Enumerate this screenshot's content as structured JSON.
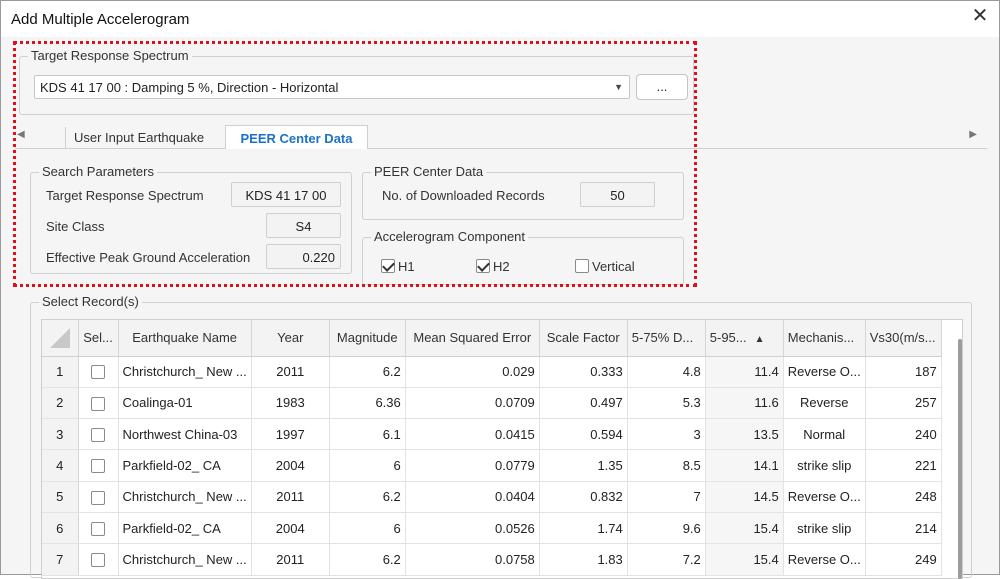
{
  "window": {
    "title": "Add Multiple Accelerogram",
    "close_icon": "✕"
  },
  "target_spectrum": {
    "legend": "Target Response Spectrum",
    "selected": "KDS 41 17 00 : Damping 5 %, Direction - Horizontal",
    "ellipsis_label": "..."
  },
  "tabs": [
    {
      "label": "User Input Earthquake",
      "active": false
    },
    {
      "label": "PEER Center Data",
      "active": true
    }
  ],
  "search": {
    "legend": "Search Parameters",
    "target_label": "Target Response Spectrum",
    "target_value": "KDS 41 17 00",
    "site_label": "Site Class",
    "site_value": "S4",
    "epga_label": "Effective Peak Ground Acceleration",
    "epga_value": "0.220"
  },
  "peer": {
    "legend": "PEER Center Data",
    "records_label": "No. of Downloaded Records",
    "records_value": "50"
  },
  "component": {
    "legend": "Accelerogram Component",
    "h1": {
      "label": "H1",
      "checked": true
    },
    "h2": {
      "label": "H2",
      "checked": true
    },
    "vertical": {
      "label": "Vertical",
      "checked": false
    }
  },
  "records": {
    "legend": "Select Record(s)",
    "columns": [
      "Sel...",
      "Earthquake Name",
      "Year",
      "Magnitude",
      "Mean Squared Error",
      "Scale Factor",
      "5-75% D...",
      "5-95...",
      "Mechanis...",
      "Vs30(m/s..."
    ],
    "sorted_column": 7,
    "rows": [
      {
        "no": "1",
        "name": "Christchurch_ New ...",
        "year": "2011",
        "mag": "6.2",
        "mse": "0.029",
        "sf": "0.333",
        "d575": "4.8",
        "d595": "11.4",
        "mech": "Reverse O...",
        "vs30": "187"
      },
      {
        "no": "2",
        "name": "Coalinga-01",
        "year": "1983",
        "mag": "6.36",
        "mse": "0.0709",
        "sf": "0.497",
        "d575": "5.3",
        "d595": "11.6",
        "mech": "Reverse",
        "vs30": "257"
      },
      {
        "no": "3",
        "name": "Northwest China-03",
        "year": "1997",
        "mag": "6.1",
        "mse": "0.0415",
        "sf": "0.594",
        "d575": "3",
        "d595": "13.5",
        "mech": "Normal",
        "vs30": "240"
      },
      {
        "no": "4",
        "name": "Parkfield-02_ CA",
        "year": "2004",
        "mag": "6",
        "mse": "0.0779",
        "sf": "1.35",
        "d575": "8.5",
        "d595": "14.1",
        "mech": "strike slip",
        "vs30": "221"
      },
      {
        "no": "5",
        "name": "Christchurch_ New ...",
        "year": "2011",
        "mag": "6.2",
        "mse": "0.0404",
        "sf": "0.832",
        "d575": "7",
        "d595": "14.5",
        "mech": "Reverse O...",
        "vs30": "248"
      },
      {
        "no": "6",
        "name": "Parkfield-02_ CA",
        "year": "2004",
        "mag": "6",
        "mse": "0.0526",
        "sf": "1.74",
        "d575": "9.6",
        "d595": "15.4",
        "mech": "strike slip",
        "vs30": "214"
      },
      {
        "no": "7",
        "name": "Christchurch_ New ...",
        "year": "2011",
        "mag": "6.2",
        "mse": "0.0758",
        "sf": "1.83",
        "d575": "7.2",
        "d595": "15.4",
        "mech": "Reverse O...",
        "vs30": "249"
      }
    ]
  },
  "colors": {
    "accent": "#1a73c8",
    "highlight": "#e0101a"
  }
}
